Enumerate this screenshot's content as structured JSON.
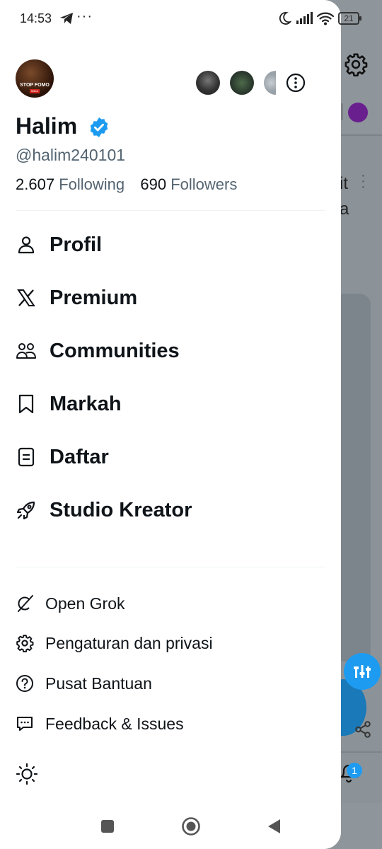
{
  "status_bar": {
    "time": "14:53",
    "dots": "···",
    "battery": "21"
  },
  "account": {
    "avatar_caption": "STOP FOMO",
    "avatar_tag": "MIKA",
    "name": "Halim",
    "handle": "@halim240101",
    "following_count": "2.607",
    "following_label": "Following",
    "followers_count": "690",
    "followers_label": "Followers"
  },
  "menu": [
    {
      "label": "Profil",
      "icon": "person-icon"
    },
    {
      "label": "Premium",
      "icon": "x-logo-icon"
    },
    {
      "label": "Communities",
      "icon": "communities-icon"
    },
    {
      "label": "Markah",
      "icon": "bookmark-icon"
    },
    {
      "label": "Daftar",
      "icon": "list-icon"
    },
    {
      "label": "Studio Kreator",
      "icon": "rocket-icon"
    }
  ],
  "secondary_menu": [
    {
      "label": "Open Grok",
      "icon": "grok-icon"
    },
    {
      "label": "Pengaturan dan privasi",
      "icon": "gear-icon"
    },
    {
      "label": "Pusat Bantuan",
      "icon": "help-icon"
    },
    {
      "label": "Feedback & Issues",
      "icon": "feedback-icon"
    }
  ],
  "background": {
    "text_line1": "it",
    "text_line2": "a",
    "notification_badge": "1"
  },
  "colors": {
    "accent": "#1d9bf0",
    "text": "#0f1419",
    "muted": "#536471",
    "overlay": "#8e959b"
  }
}
